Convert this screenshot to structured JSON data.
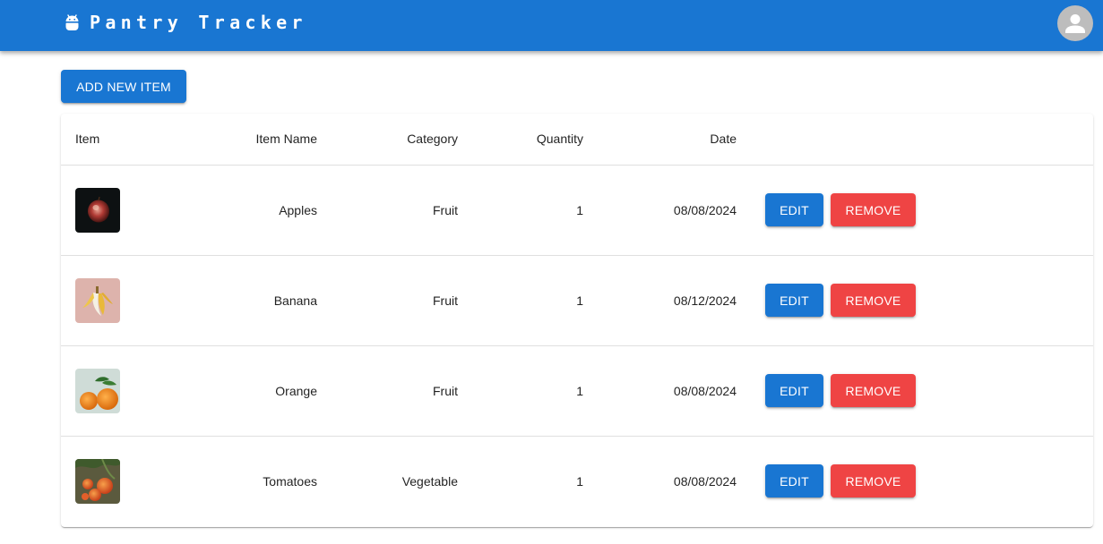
{
  "app": {
    "title": "Pantry Tracker",
    "logo_icon": "android-icon",
    "avatar_icon": "person-icon",
    "colors": {
      "primary": "#1976d2",
      "danger": "#ef4444",
      "avatar": "#bdbdbd"
    }
  },
  "toolbar": {
    "add_label": "ADD NEW ITEM"
  },
  "table": {
    "headers": {
      "item": "Item",
      "name": "Item Name",
      "category": "Category",
      "quantity": "Quantity",
      "date": "Date"
    },
    "edit_label": "EDIT",
    "remove_label": "REMOVE",
    "rows": [
      {
        "name": "Apples",
        "category": "Fruit",
        "quantity": "1",
        "date": "08/08/2024",
        "thumb": "apple-photo"
      },
      {
        "name": "Banana",
        "category": "Fruit",
        "quantity": "1",
        "date": "08/12/2024",
        "thumb": "banana-photo"
      },
      {
        "name": "Orange",
        "category": "Fruit",
        "quantity": "1",
        "date": "08/08/2024",
        "thumb": "orange-photo"
      },
      {
        "name": "Tomatoes",
        "category": "Vegetable",
        "quantity": "1",
        "date": "08/08/2024",
        "thumb": "tomato-photo"
      }
    ]
  }
}
